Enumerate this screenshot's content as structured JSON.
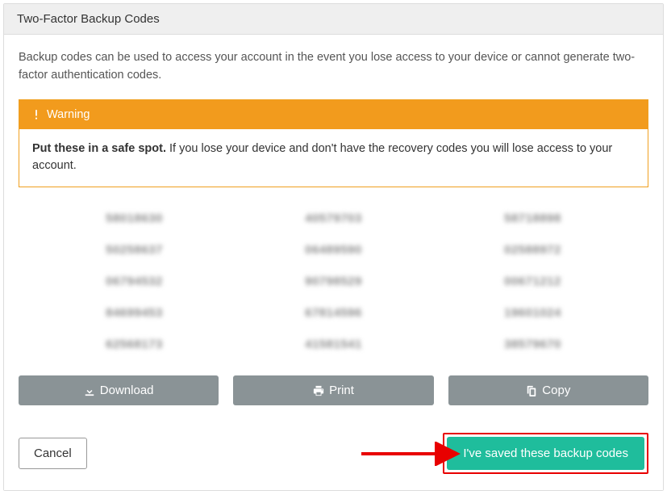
{
  "panel": {
    "title": "Two-Factor Backup Codes",
    "intro": "Backup codes can be used to access your account in the event you lose access to your device or cannot generate two-factor authentication codes."
  },
  "alert": {
    "heading": "Warning",
    "strong": "Put these in a safe spot.",
    "body": "If you lose your device and don't have the recovery codes you will lose access to your account."
  },
  "codes": [
    "58018630",
    "40579703",
    "58718898",
    "50258637",
    "06489590",
    "02588972",
    "06794532",
    "90798529",
    "00671212",
    "84699453",
    "67814596",
    "19601024",
    "62568173",
    "41581541",
    "38579670"
  ],
  "actions": {
    "download": "Download",
    "print": "Print",
    "copy": "Copy"
  },
  "bottom": {
    "cancel": "Cancel",
    "saved": "I've saved these backup codes"
  }
}
